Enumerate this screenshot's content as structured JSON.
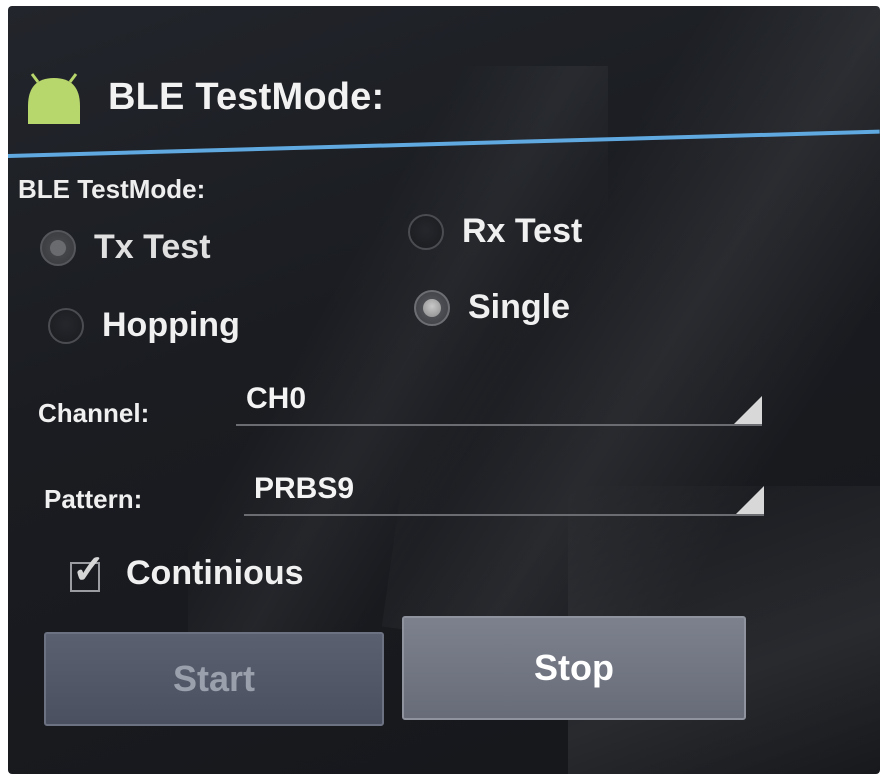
{
  "app": {
    "title": "BLE TestMode:",
    "icon": "android-icon"
  },
  "section": {
    "label": "BLE TestMode:"
  },
  "test_type": {
    "options": [
      {
        "label": "Tx Test",
        "selected": true,
        "enabled": false
      },
      {
        "label": "Rx Test",
        "selected": false,
        "enabled": true
      }
    ]
  },
  "mode": {
    "options": [
      {
        "label": "Hopping",
        "selected": false
      },
      {
        "label": "Single",
        "selected": true
      }
    ]
  },
  "channel": {
    "label": "Channel:",
    "value": "CH0"
  },
  "pattern": {
    "label": "Pattern:",
    "value": "PRBS9"
  },
  "continuous": {
    "label": "Continious",
    "checked": true
  },
  "buttons": {
    "start_label": "Start",
    "stop_label": "Stop"
  },
  "colors": {
    "accent": "#5fa9e0",
    "android_green": "#a4c639"
  }
}
